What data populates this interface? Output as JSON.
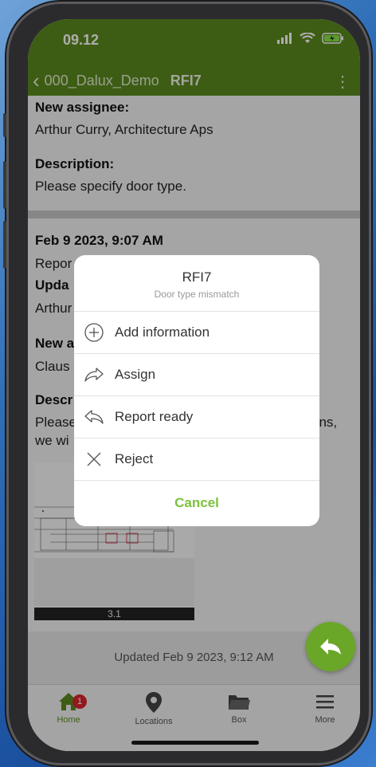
{
  "status_bar": {
    "time": "09.12"
  },
  "nav": {
    "project": "000_Dalux_Demo",
    "rfi": "RFI7"
  },
  "content": {
    "new_assignee_label": "New assignee:",
    "new_assignee_value": "Arthur Curry, Architecture Aps",
    "description_label": "Description:",
    "description_value": "Please specify door type.",
    "entry2_date": "Feb 9 2023, 9:07 AM",
    "entry2_line1": "Repor",
    "entry2_updated_label": "Upda",
    "entry2_updated_value": "Arthur",
    "entry2_new_label": "New a",
    "entry2_new_value": "Claus",
    "entry2_desc_label": "Descr",
    "entry2_desc_line1_left": "Please",
    "entry2_desc_line1_right": "ons,",
    "entry2_desc_line2": "we wi",
    "drawing_caption": "3.1",
    "updated_text": "Updated Feb 9 2023, 9:12 AM"
  },
  "action_sheet": {
    "title": "RFI7",
    "subtitle": "Door type mismatch",
    "items": [
      {
        "label": "Add information",
        "icon": "plus-circle-icon"
      },
      {
        "label": "Assign",
        "icon": "forward-arrow-icon"
      },
      {
        "label": "Report ready",
        "icon": "reply-arrow-icon"
      },
      {
        "label": "Reject",
        "icon": "x-icon"
      }
    ],
    "cancel": "Cancel"
  },
  "tab_bar": {
    "tabs": [
      {
        "label": "Home",
        "icon": "home-icon",
        "badge": "1",
        "active": true
      },
      {
        "label": "Locations",
        "icon": "location-pin-icon"
      },
      {
        "label": "Box",
        "icon": "folder-icon"
      },
      {
        "label": "More",
        "icon": "menu-icon"
      }
    ]
  },
  "colors": {
    "brand_green": "#5b8a1e",
    "accent_green": "#7cc23b",
    "badge_red": "#d9262e"
  }
}
